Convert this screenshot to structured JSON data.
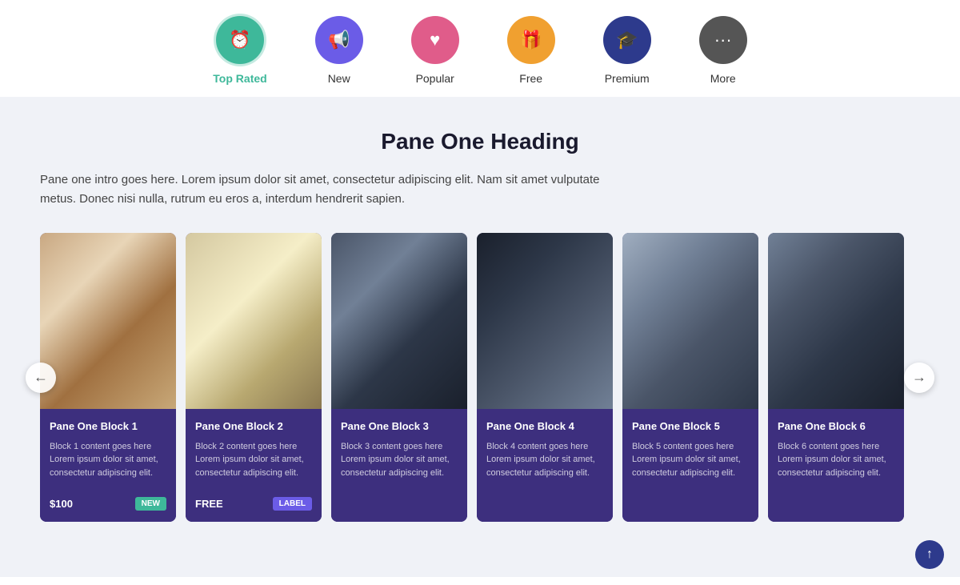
{
  "nav": {
    "items": [
      {
        "id": "top-rated",
        "label": "Top Rated",
        "icon": "⏰",
        "iconClass": "teal",
        "active": true
      },
      {
        "id": "new",
        "label": "New",
        "icon": "📢",
        "iconClass": "purple",
        "active": false
      },
      {
        "id": "popular",
        "label": "Popular",
        "icon": "♥",
        "iconClass": "pink",
        "active": false
      },
      {
        "id": "free",
        "label": "Free",
        "icon": "🎁",
        "iconClass": "orange",
        "active": false
      },
      {
        "id": "premium",
        "label": "Premium",
        "icon": "🎓",
        "iconClass": "navy",
        "active": false
      },
      {
        "id": "more",
        "label": "More",
        "icon": "···",
        "iconClass": "dark",
        "active": false
      }
    ]
  },
  "pane": {
    "heading": "Pane One Heading",
    "intro": "Pane one intro goes here. Lorem ipsum dolor sit amet, consectetur adipiscing elit. Nam sit amet vulputate metus. Donec nisi nulla, rutrum eu eros a, interdum hendrerit sapien."
  },
  "cards": [
    {
      "id": "block-1",
      "title": "Pane One Block 1",
      "text": "Block 1 content goes here Lorem ipsum dolor sit amet, consectetur adipiscing elit.",
      "price": "$100",
      "badge": "NEW",
      "badgeType": "new",
      "imgClass": "img-1"
    },
    {
      "id": "block-2",
      "title": "Pane One Block 2",
      "text": "Block 2 content goes here Lorem ipsum dolor sit amet, consectetur adipiscing elit.",
      "price": "FREE",
      "badge": "Label",
      "badgeType": "label",
      "imgClass": "img-2"
    },
    {
      "id": "block-3",
      "title": "Pane One Block 3",
      "text": "Block 3 content goes here Lorem ipsum dolor sit amet, consectetur adipiscing elit.",
      "price": "",
      "badge": "",
      "badgeType": "",
      "imgClass": "img-3"
    },
    {
      "id": "block-4",
      "title": "Pane One Block 4",
      "text": "Block 4 content goes here Lorem ipsum dolor sit amet, consectetur adipiscing elit.",
      "price": "",
      "badge": "",
      "badgeType": "",
      "imgClass": "img-4"
    },
    {
      "id": "block-5",
      "title": "Pane One Block 5",
      "text": "Block 5 content goes here Lorem ipsum dolor sit amet, consectetur adipiscing elit.",
      "price": "",
      "badge": "",
      "badgeType": "",
      "imgClass": "img-5"
    },
    {
      "id": "block-6",
      "title": "Pane One Block 6",
      "text": "Block 6 content goes here Lorem ipsum dolor sit amet, consectetur adipiscing elit.",
      "price": "",
      "badge": "",
      "badgeType": "",
      "imgClass": "img-6"
    }
  ],
  "arrows": {
    "left": "←",
    "right": "→"
  },
  "scrollBtn": "↑"
}
